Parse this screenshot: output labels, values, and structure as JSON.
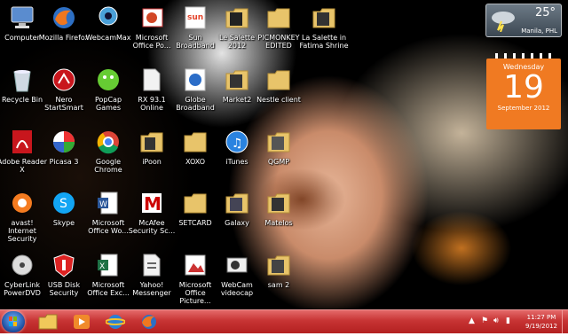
{
  "desktop": {
    "icons": [
      {
        "label": "Computer",
        "icon": "computer-icon"
      },
      {
        "label": "Mozilla Firefox",
        "icon": "firefox-icon"
      },
      {
        "label": "WebcamMax",
        "icon": "webcam-icon"
      },
      {
        "label": "Microsoft Office Po...",
        "icon": "powerpoint-icon"
      },
      {
        "label": "Sun Broadband",
        "icon": "sun-broadband-icon"
      },
      {
        "label": "Le Salette 2012",
        "icon": "folder-icon"
      },
      {
        "label": "PICMONKEY EDITED",
        "icon": "folder-icon"
      },
      {
        "label": "La Salette in Fatima Shrine",
        "icon": "folder-icon"
      },
      {
        "label": "Recycle Bin",
        "icon": "recycle-bin-icon"
      },
      {
        "label": "Nero StartSmart",
        "icon": "nero-icon"
      },
      {
        "label": "PopCap Games",
        "icon": "popcap-icon"
      },
      {
        "label": "RX 93.1 Online",
        "icon": "file-icon"
      },
      {
        "label": "Globe Broadband",
        "icon": "globe-broadband-icon"
      },
      {
        "label": "Market2",
        "icon": "folder-icon"
      },
      {
        "label": "Nestle client",
        "icon": "folder-icon"
      },
      {
        "label": "Adobe Reader X",
        "icon": "adobe-reader-icon"
      },
      {
        "label": "Picasa 3",
        "icon": "picasa-icon"
      },
      {
        "label": "Google Chrome",
        "icon": "chrome-icon"
      },
      {
        "label": "iPoon",
        "icon": "folder-icon"
      },
      {
        "label": "XOXO",
        "icon": "folder-icon"
      },
      {
        "label": "iTunes",
        "icon": "itunes-icon"
      },
      {
        "label": "QGMP",
        "icon": "folder-icon"
      },
      {
        "label": "avast! Internet Security",
        "icon": "avast-icon"
      },
      {
        "label": "Skype",
        "icon": "skype-icon"
      },
      {
        "label": "Microsoft Office Wo...",
        "icon": "word-icon"
      },
      {
        "label": "McAfee Security Sc...",
        "icon": "mcafee-icon"
      },
      {
        "label": "SETCARD",
        "icon": "folder-icon"
      },
      {
        "label": "Galaxy",
        "icon": "folder-icon"
      },
      {
        "label": "Matelos",
        "icon": "folder-icon"
      },
      {
        "label": "CyberLink PowerDVD",
        "icon": "powerdvd-icon"
      },
      {
        "label": "USB Disk Security",
        "icon": "usb-security-icon"
      },
      {
        "label": "Microsoft Office Exc...",
        "icon": "excel-icon"
      },
      {
        "label": "Yahoo! Messenger",
        "icon": "file-icon"
      },
      {
        "label": "Microsoft Office Picture...",
        "icon": "picture-manager-icon"
      },
      {
        "label": "WebCam videocap",
        "icon": "webcam-video-icon"
      },
      {
        "label": "sam 2",
        "icon": "folder-icon"
      }
    ]
  },
  "weather_gadget": {
    "temperature": "25°",
    "city": "Manila, PHL"
  },
  "calendar_gadget": {
    "weekday": "Wednesday",
    "day": "19",
    "month_year": "September 2012"
  },
  "taskbar": {
    "pinned": [
      {
        "icon": "explorer-folder-icon"
      },
      {
        "icon": "media-player-icon"
      },
      {
        "icon": "internet-explorer-icon"
      },
      {
        "icon": "firefox-icon"
      }
    ],
    "clock": {
      "time": "11:27 PM",
      "date": "9/19/2012"
    }
  },
  "colors": {
    "taskbar": "#c73434",
    "calendar": "#f07a22"
  }
}
